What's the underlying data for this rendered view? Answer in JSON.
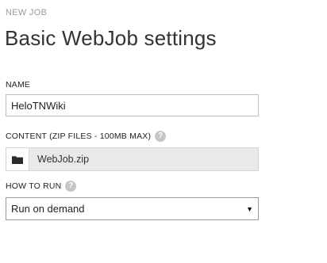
{
  "header": {
    "eyebrow": "NEW JOB",
    "title": "Basic WebJob settings"
  },
  "form": {
    "name": {
      "label": "NAME",
      "value": "HeloTNWiki"
    },
    "content": {
      "label": "CONTENT (ZIP FILES - 100MB MAX)",
      "file_name": "WebJob.zip",
      "button_icon": "folder-icon"
    },
    "how_to_run": {
      "label": "HOW TO RUN",
      "selected": "Run on demand"
    },
    "help_glyph": "?"
  },
  "colors": {
    "help_icon_bg": "#c6c6c6",
    "file_row_bg": "#e9e9e9",
    "muted_text": "#9a9a9a"
  }
}
